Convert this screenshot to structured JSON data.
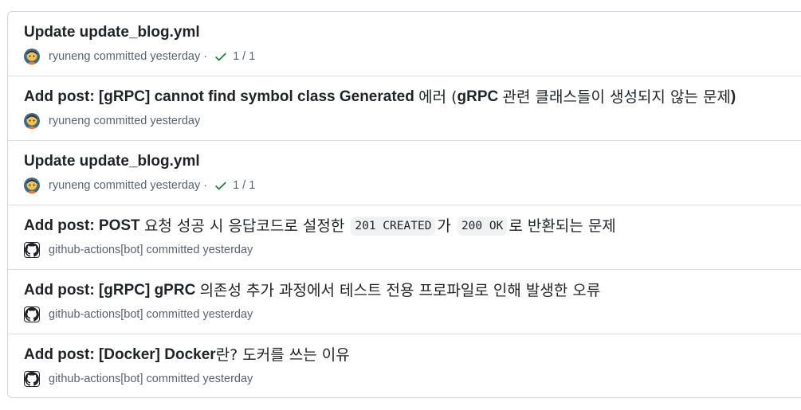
{
  "commits": [
    {
      "title_segments": [
        {
          "text": "Update update_blog.yml",
          "type": "text"
        }
      ],
      "author": "ryuneng",
      "author_type": "user",
      "committed": "committed yesterday",
      "status": {
        "icon": "check-icon",
        "count": "1 / 1",
        "color": "#1a7f37"
      }
    },
    {
      "title_segments": [
        {
          "text": "Add post: [gRPC] cannot find symbol class Generated ",
          "type": "text"
        },
        {
          "text": "에러 (",
          "type": "hangul"
        },
        {
          "text": "gRPC ",
          "type": "text"
        },
        {
          "text": "관련 클래스들이 생성되지 않는 문제",
          "type": "hangul"
        },
        {
          "text": ")",
          "type": "text"
        }
      ],
      "author": "ryuneng",
      "author_type": "user",
      "committed": "committed yesterday",
      "status": null
    },
    {
      "title_segments": [
        {
          "text": "Update update_blog.yml",
          "type": "text"
        }
      ],
      "author": "ryuneng",
      "author_type": "user",
      "committed": "committed yesterday",
      "status": {
        "icon": "check-icon",
        "count": "1 / 1",
        "color": "#1a7f37"
      }
    },
    {
      "title_segments": [
        {
          "text": "Add post: POST ",
          "type": "text"
        },
        {
          "text": "요청 성공 시 응답코드로 설정한 ",
          "type": "hangul"
        },
        {
          "text": "201 CREATED",
          "type": "code"
        },
        {
          "text": "가 ",
          "type": "hangul"
        },
        {
          "text": "200 OK",
          "type": "code"
        },
        {
          "text": "로 반환되는 문제",
          "type": "hangul"
        }
      ],
      "author": "github-actions[bot]",
      "author_type": "bot",
      "committed": "committed yesterday",
      "status": null
    },
    {
      "title_segments": [
        {
          "text": "Add post: [gRPC] gPRC ",
          "type": "text"
        },
        {
          "text": "의존성 추가 과정에서 테스트 전용 프로파일로 인해 발생한 오류",
          "type": "hangul"
        }
      ],
      "author": "github-actions[bot]",
      "author_type": "bot",
      "committed": "committed yesterday",
      "status": null
    },
    {
      "title_segments": [
        {
          "text": "Add post: [Docker] Docker",
          "type": "text"
        },
        {
          "text": "란? 도커를 쓰는 이유",
          "type": "hangul"
        }
      ],
      "author": "github-actions[bot]",
      "author_type": "bot",
      "committed": "committed yesterday",
      "status": null
    }
  ],
  "separator": "·",
  "colors": {
    "border": "#d0d7de",
    "muted": "#59636e",
    "success": "#1a7f37",
    "code_bg": "#eff1f3"
  }
}
